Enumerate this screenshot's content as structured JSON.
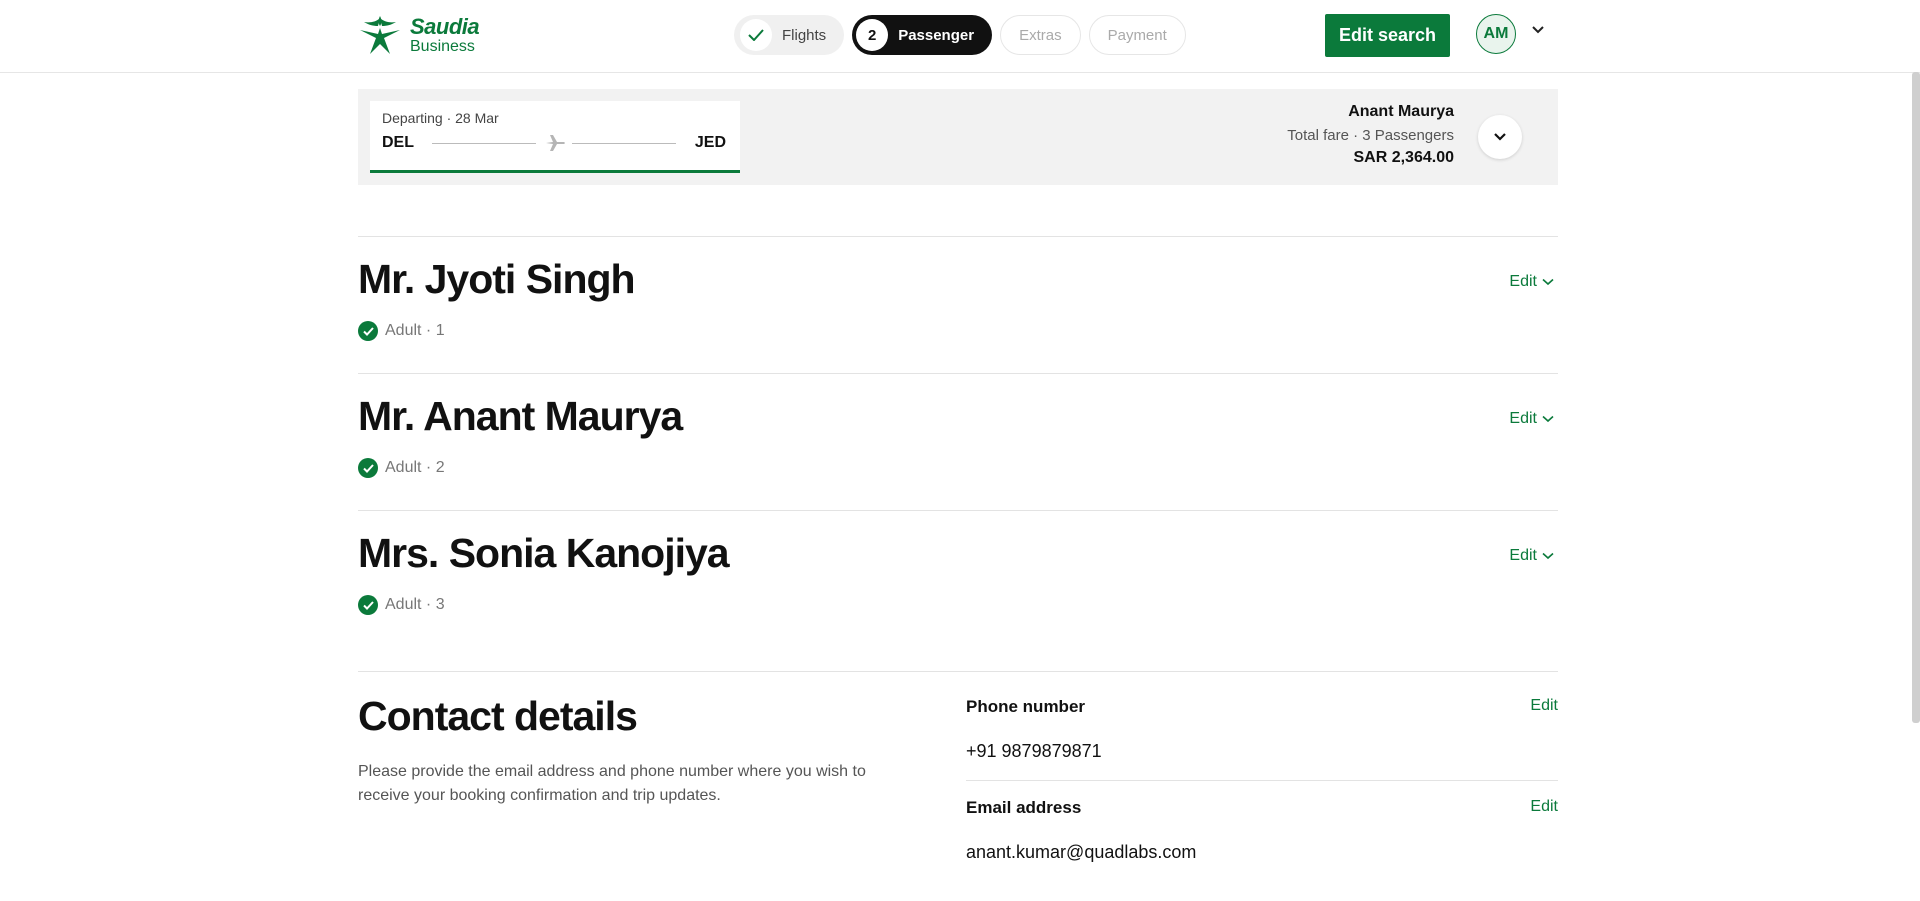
{
  "brand": {
    "name": "Saudia",
    "sub": "Business",
    "color": "#0b7a3b"
  },
  "steps": [
    {
      "label": "Flights",
      "state": "done",
      "icon": "check-icon"
    },
    {
      "number": "2",
      "label": "Passenger",
      "state": "active"
    },
    {
      "label": "Extras",
      "state": "pending"
    },
    {
      "label": "Payment",
      "state": "pending"
    }
  ],
  "header": {
    "edit_search": "Edit search",
    "avatar_initials": "AM"
  },
  "summary": {
    "departing": "Departing · 28 Mar",
    "from": "DEL",
    "to": "JED",
    "lead_passenger": "Anant Maurya",
    "fare_label": "Total fare · 3 Passengers",
    "total": "SAR 2,364.00"
  },
  "passengers": [
    {
      "name": "Mr. Jyoti Singh",
      "type": "Adult",
      "index": "· 1",
      "edit": "Edit"
    },
    {
      "name": "Mr. Anant Maurya",
      "type": "Adult",
      "index": "· 2",
      "edit": "Edit"
    },
    {
      "name": "Mrs. Sonia Kanojiya",
      "type": "Adult",
      "index": "· 3",
      "edit": "Edit"
    }
  ],
  "contact": {
    "title": "Contact details",
    "description": "Please provide the email address and phone number where you wish to receive your booking confirmation and trip updates.",
    "phone_label": "Phone number",
    "phone_value": "+91 9879879871",
    "email_label": "Email address",
    "email_value": "anant.kumar@quadlabs.com",
    "edit": "Edit"
  }
}
